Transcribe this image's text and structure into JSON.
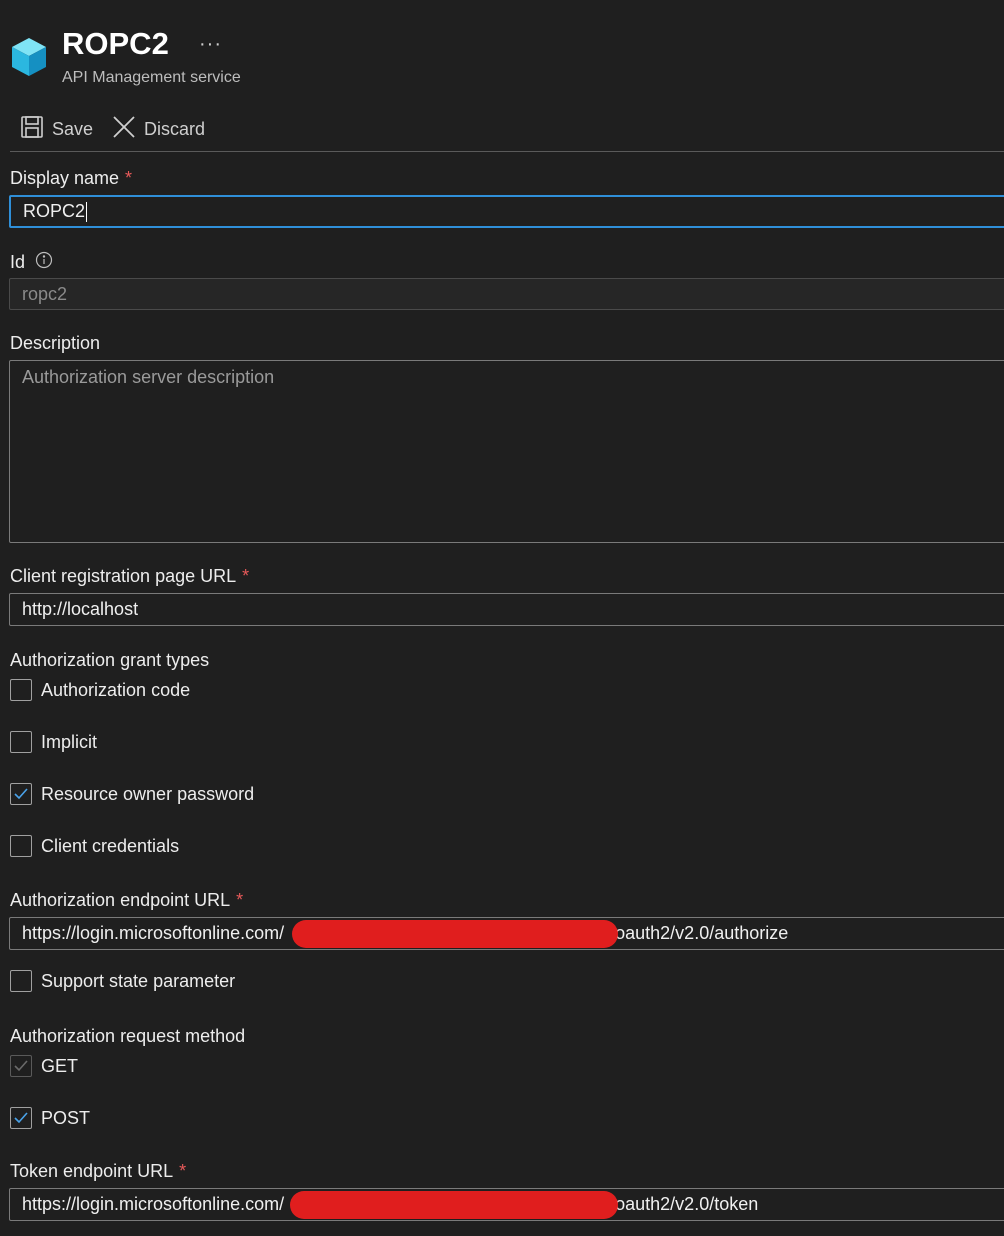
{
  "header": {
    "title": "ROPC2",
    "subtitle": "API Management service",
    "more": "···"
  },
  "toolbar": {
    "save_label": "Save",
    "discard_label": "Discard"
  },
  "form": {
    "display_name": {
      "label": "Display name",
      "required": "*",
      "value": "ROPC2"
    },
    "id": {
      "label": "Id",
      "value": "ropc2"
    },
    "description": {
      "label": "Description",
      "placeholder": "Authorization server description"
    },
    "client_registration_url": {
      "label": "Client registration page URL",
      "required": "*",
      "value": "http://localhost"
    },
    "grant_types": {
      "label": "Authorization grant types",
      "items": [
        {
          "label": "Authorization code",
          "checked": false
        },
        {
          "label": "Implicit",
          "checked": false
        },
        {
          "label": "Resource owner password",
          "checked": true
        },
        {
          "label": "Client credentials",
          "checked": false
        }
      ]
    },
    "authorization_endpoint": {
      "label": "Authorization endpoint URL",
      "required": "*",
      "value_prefix": "https://login.microsoftonline.com/",
      "value_suffix": "/oauth2/v2.0/authorize"
    },
    "support_state": {
      "label": "Support state parameter",
      "checked": false
    },
    "request_method": {
      "label": "Authorization request method",
      "items": [
        {
          "label": "GET",
          "checked": true,
          "disabled": true
        },
        {
          "label": "POST",
          "checked": true,
          "disabled": false
        }
      ]
    },
    "token_endpoint": {
      "label": "Token endpoint URL",
      "required": "*",
      "value_prefix": "https://login.microsoftonline.com/",
      "value_suffix": "/oauth2/v2.0/token"
    }
  },
  "colors": {
    "accent": "#2f8fd8",
    "required": "#e85a5a",
    "redaction": "#e01e1e",
    "check": "#4aa3ea"
  }
}
